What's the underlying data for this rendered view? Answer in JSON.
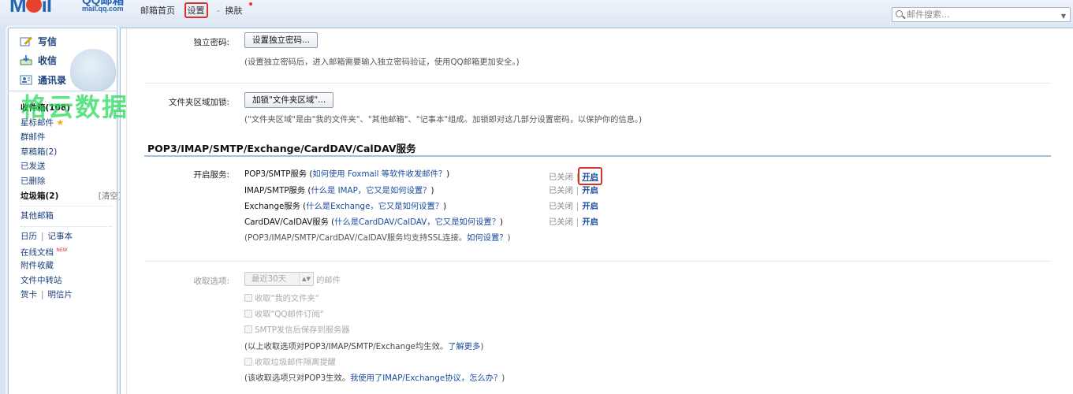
{
  "header": {
    "logo_qq": "QQ邮箱",
    "logo_url": "mail.qq.com",
    "nav": {
      "home": "邮箱首页",
      "settings": "设置",
      "sep": "-",
      "skin": "换肤"
    },
    "search_placeholder": "邮件搜索..."
  },
  "sidebar": {
    "compose": "写信",
    "receive": "收信",
    "contacts": "通讯录",
    "watermark": "格云数据",
    "folders": {
      "inbox": "收件箱(108)",
      "starred": "星标邮件",
      "group": "群邮件",
      "drafts": "草稿箱(2)",
      "sent": "已发送",
      "deleted": "已删除",
      "spam": "垃圾箱(2)",
      "clear": "[清空]",
      "other": "其他邮箱",
      "calendar": "日历",
      "notes": "记事本",
      "docs": "在线文档",
      "new_badge": "NEW",
      "attachments": "附件收藏",
      "transfer": "文件中转站",
      "card": "贺卡",
      "postcard": "明信片"
    }
  },
  "main": {
    "independent_password": {
      "label": "独立密码:",
      "button": "设置独立密码...",
      "hint": "(设置独立密码后，进入邮箱需要输入独立密码验证，使用QQ邮箱更加安全。)"
    },
    "folder_lock": {
      "label": "文件夹区域加锁:",
      "button": "加锁\"文件夹区域\"...",
      "hint": "(\"文件夹区域\"是由\"我的文件夹\"、\"其他邮箱\"、\"记事本\"组成。加锁即对这几部分设置密码，以保护你的信息。)"
    },
    "section_title": "POP3/IMAP/SMTP/Exchange/CardDAV/CalDAV服务",
    "services_label": "开启服务:",
    "services": [
      {
        "name": "POP3/SMTP服务 (",
        "link": "如何使用 Foxmail 等软件收发邮件？",
        "close": ")",
        "status": "已关闭",
        "bar": "|",
        "action": "开启"
      },
      {
        "name": "IMAP/SMTP服务 (",
        "link": "什么是 IMAP，它又是如何设置？",
        "close": ")",
        "status": "已关闭",
        "bar": "|",
        "action": "开启"
      },
      {
        "name": "Exchange服务 (",
        "link": "什么是Exchange，它又是如何设置？",
        "close": ")",
        "status": "已关闭",
        "bar": "|",
        "action": "开启"
      },
      {
        "name": "CardDAV/CalDAV服务 (",
        "link": "什么是CardDAV/CalDAV，它又是如何设置？",
        "close": ")",
        "status": "已关闭",
        "bar": "|",
        "action": "开启"
      }
    ],
    "ssl_hint": "(POP3/IMAP/SMTP/CardDAV/CalDAV服务均支持SSL连接。",
    "ssl_link": "如何设置？",
    "ssl_close": ")",
    "receive": {
      "label": "收取选项:",
      "select_value": "最近30天",
      "select_suffix": "的邮件",
      "options": [
        "收取\"我的文件夹\"",
        "收取\"QQ邮件订阅\"",
        "SMTP发信后保存到服务器"
      ],
      "note1": "(以上收取选项对POP3/IMAP/SMTP/Exchange均生效。",
      "note1_link": "了解更多",
      "note1_close": ")",
      "spam_option": "收取垃圾邮件隔离提醒",
      "note2": "(该收取选项只对POP3生效。",
      "note2_link": "我使用了IMAP/Exchange协议，怎么办？",
      "note2_close": ")"
    }
  }
}
